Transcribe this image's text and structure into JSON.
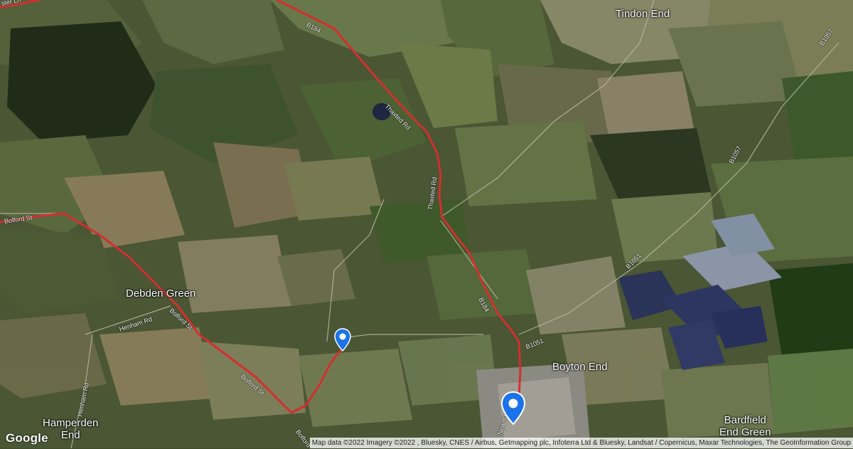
{
  "map": {
    "logo": "Google",
    "attribution": "Map data ©2022 Imagery ©2022 , Bluesky, CNES / Airbus, Getmapping plc, Infoterra Ltd & Bluesky, Landsat / Copernicus, Maxar Technologies, The GeoInformation Group",
    "colors": {
      "route": "#d32f2f",
      "pin": "#1a73e8",
      "pin_dot": "#ffffff"
    },
    "places": {
      "tindon_end": "Tindon End",
      "debden_green": "Debden Green",
      "boyton_end": "Boyton End",
      "hamperden_end_1": "Hamperden",
      "hamperden_end_2": "End",
      "bardfield_end_green_1": "Bardfield",
      "bardfield_end_green_2": "End Green"
    },
    "roads": {
      "b184_top": "B184",
      "thaxted_rd_1": "Thaxted Rd",
      "thaxted_rd_2": "Thaxted Rd",
      "b184_mid": "B184",
      "b1051_mid": "B1051",
      "b1051_right": "B1051",
      "b1057_top": "B1057",
      "b1057_right": "B1057",
      "bolford_st_left": "Bolford St",
      "bolford_st_mid": "Bolford St",
      "bolford_st_low": "Bolford St",
      "bolford_bottom": "Bolford",
      "henham_rd_1": "Henham Rd",
      "henham_rd_2": "Henham Rd",
      "new_st": "New St",
      "ster_ln": "ster Ln"
    },
    "pins": [
      {
        "name": "start-marker",
        "icon": "map-pin-icon"
      },
      {
        "name": "destination-marker",
        "icon": "map-pin-icon"
      }
    ]
  }
}
